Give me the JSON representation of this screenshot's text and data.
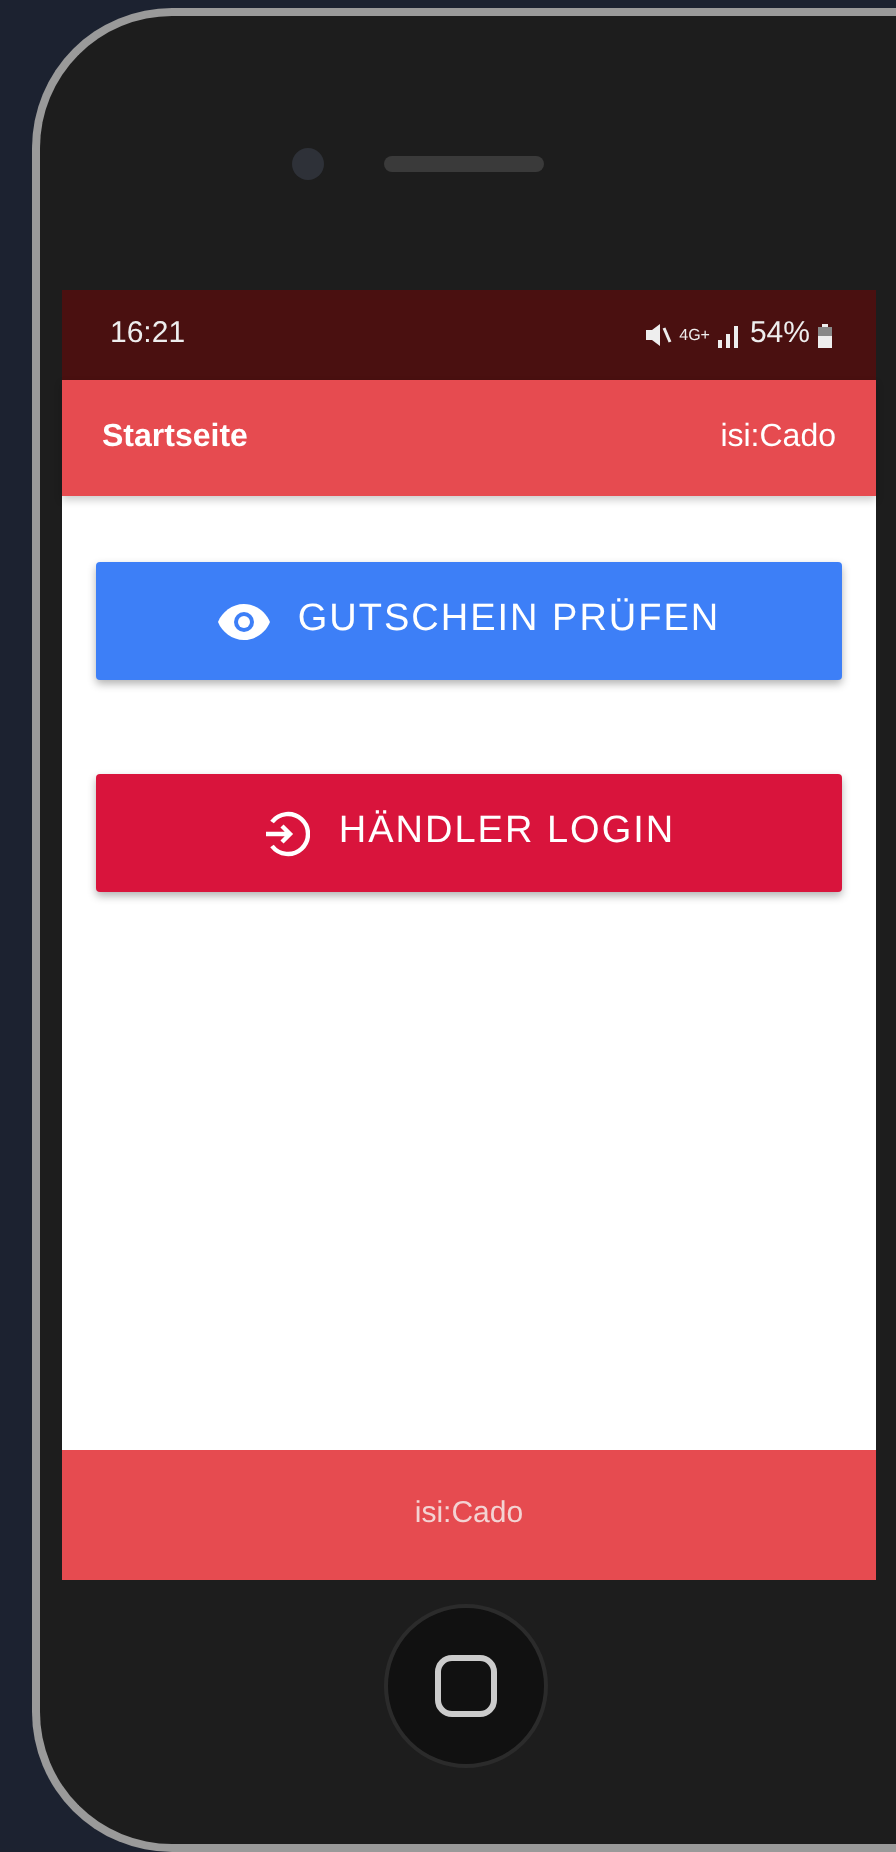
{
  "status_bar": {
    "time": "16:21",
    "network": "4G+",
    "battery": "54%"
  },
  "app_bar": {
    "title": "Startseite",
    "brand": "isi:Cado"
  },
  "buttons": [
    {
      "label": "GUTSCHEIN PRÜFEN",
      "kind": "check"
    },
    {
      "label": "HÄNDLER LOGIN",
      "kind": "login"
    }
  ],
  "footer": {
    "text": "isi:Cado"
  }
}
